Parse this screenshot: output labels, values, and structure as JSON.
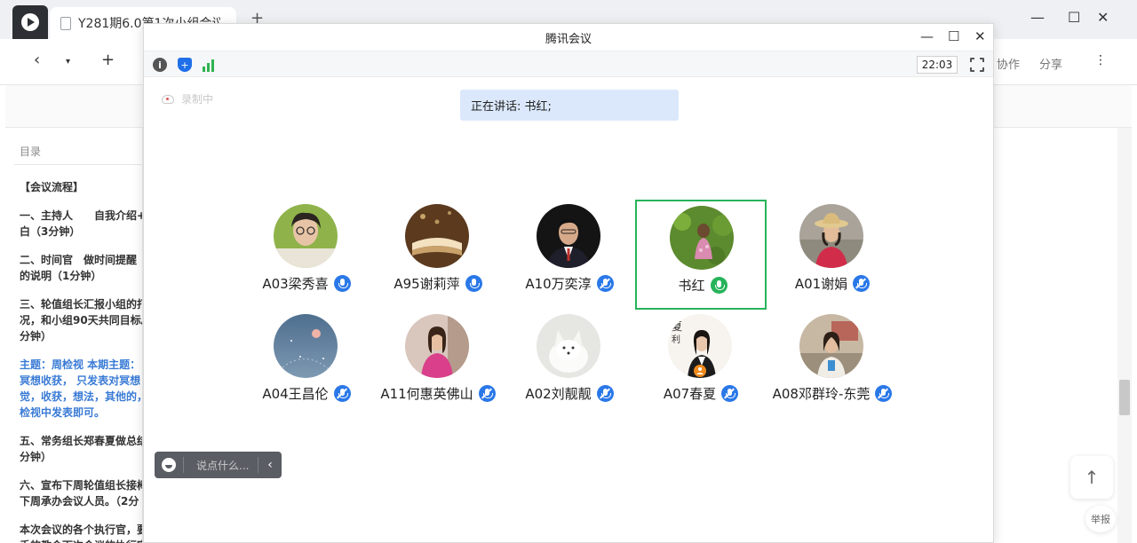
{
  "browser": {
    "tab_title": "Y281期6.0第1次小组会议",
    "toolbar": {
      "collaborate": "协作",
      "share": "分享"
    },
    "toc_label": "目录",
    "doc_lines": [
      {
        "text": "【会议流程】",
        "style": "normal"
      },
      {
        "text": "",
        "style": "gap"
      },
      {
        "text": "一、主持人　　自我介绍+",
        "style": "normal"
      },
      {
        "text": "白（3分钟）",
        "style": "normal"
      },
      {
        "text": "",
        "style": "gap"
      },
      {
        "text": " 二、时间官　做时间提醒",
        "style": "normal"
      },
      {
        "text": "的说明（1分钟）",
        "style": "normal"
      },
      {
        "text": "",
        "style": "gap"
      },
      {
        "text": "三、轮值组长汇报小组的打",
        "style": "normal"
      },
      {
        "text": "况，和小组90天共同目标。",
        "style": "normal"
      },
      {
        "text": "分钟）",
        "style": "normal"
      },
      {
        "text": "",
        "style": "gap"
      },
      {
        "text": "主题：周检视  本期主题：",
        "style": "blue"
      },
      {
        "text": "冥想收获，  只发表对冥想",
        "style": "blue"
      },
      {
        "text": "觉，收获，想法，其他的，",
        "style": "blue"
      },
      {
        "text": "检视中发表即可。",
        "style": "blue"
      },
      {
        "text": "",
        "style": "gap"
      },
      {
        "text": "五、常务组长郑春夏做总结",
        "style": "normal"
      },
      {
        "text": "分钟）",
        "style": "normal"
      },
      {
        "text": "",
        "style": "gap"
      },
      {
        "text": "六、宣布下周轮值组长接棒",
        "style": "normal"
      },
      {
        "text": "下周承办会议人员。（2分",
        "style": "normal"
      },
      {
        "text": "",
        "style": "gap"
      },
      {
        "text": "本次会议的各个执行官，要",
        "style": "normal"
      },
      {
        "text": "手的教会下次会议的执行官",
        "style": "normal"
      }
    ],
    "scroll_top_icon": "↑",
    "report_label": "举报"
  },
  "meeting": {
    "title": "腾讯会议",
    "timer": "22:03",
    "recording_label": "录制中",
    "speaking_label": "正在讲话: 书红;",
    "chat_placeholder": "说点什么...",
    "colors": {
      "accent": "#2a78e8",
      "active_border": "#27b35a",
      "speaking_bg": "#dbe8fb"
    },
    "participants": [
      {
        "name": "A03梁秀喜",
        "mic": "on",
        "active": false,
        "avatar": "portrait-woman-glasses"
      },
      {
        "name": "A95谢莉萍",
        "mic": "on",
        "active": false,
        "avatar": "open-book"
      },
      {
        "name": "A10万奕淳",
        "mic": "muted",
        "active": false,
        "avatar": "portrait-man-suit"
      },
      {
        "name": "书红",
        "mic": "speaking",
        "active": true,
        "avatar": "child-in-garden"
      },
      {
        "name": "A01谢娟",
        "mic": "muted",
        "active": false,
        "avatar": "woman-with-hat"
      },
      {
        "name": "A04王昌伦",
        "mic": "muted",
        "active": false,
        "avatar": "night-sky-lantern"
      },
      {
        "name": "A11何惠英佛山",
        "mic": "muted",
        "active": false,
        "avatar": "woman-pink-dress"
      },
      {
        "name": "A02刘靓靓",
        "mic": "muted",
        "active": false,
        "avatar": "white-fox"
      },
      {
        "name": "A07春夏",
        "mic": "muted",
        "active": false,
        "avatar": "woman-business-poster"
      },
      {
        "name": "A08邓群玲-东莞",
        "mic": "muted",
        "active": false,
        "avatar": "woman-outdoor"
      }
    ]
  }
}
